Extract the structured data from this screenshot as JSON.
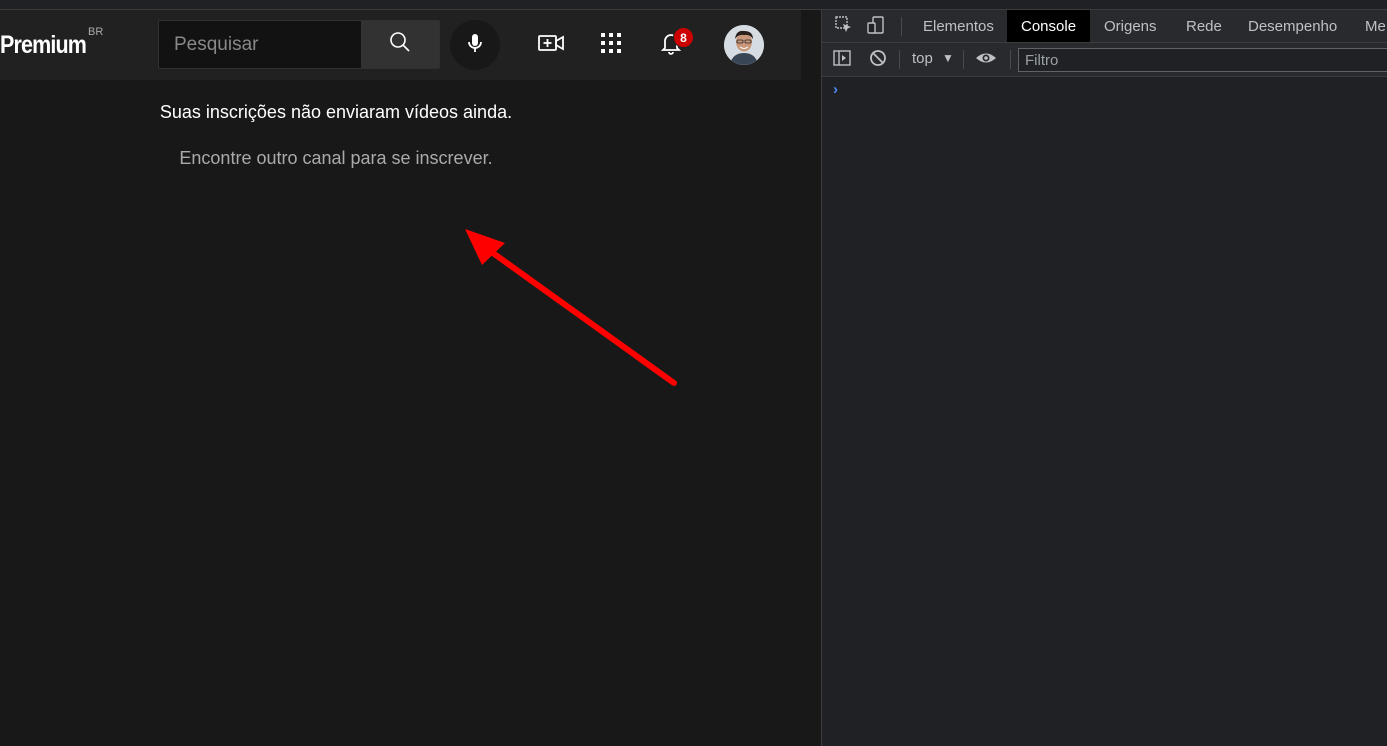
{
  "youtube": {
    "logo": "Premium",
    "logo_country": "BR",
    "search": {
      "placeholder": "Pesquisar"
    },
    "notifications_count": "8",
    "empty_title": "Suas inscrições não enviaram vídeos ainda.",
    "empty_subtitle": "Encontre outro canal para se inscrever."
  },
  "devtools": {
    "tabs": [
      "Elementos",
      "Console",
      "Origens",
      "Rede",
      "Desempenho",
      "Me"
    ],
    "active_tab": "Console",
    "context": "top",
    "filter_placeholder": "Filtro",
    "prompt": "›"
  },
  "annotation": {
    "arrow_color": "#ff0000"
  },
  "colors": {
    "badge": "#cc0000",
    "prompt": "#4a8af4"
  }
}
